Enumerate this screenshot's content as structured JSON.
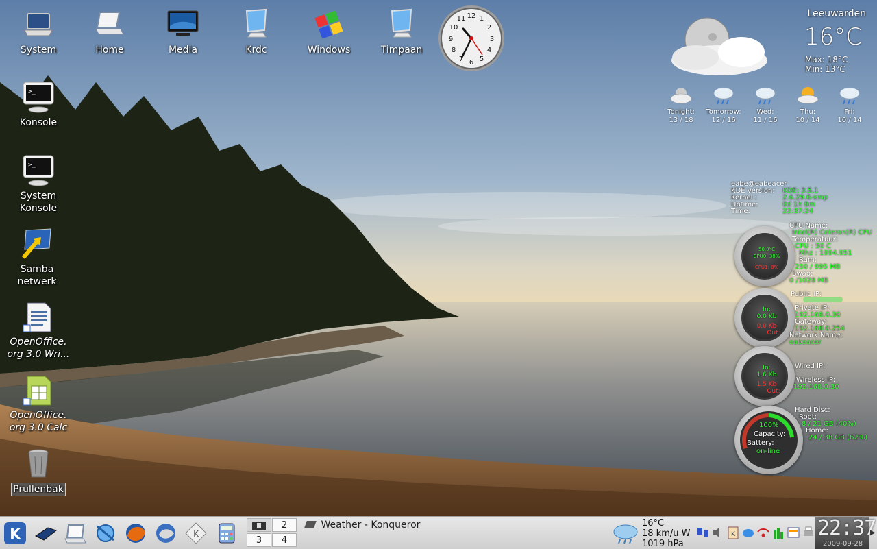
{
  "desktop_icons": [
    {
      "label": "System",
      "icon": "laptop-icon"
    },
    {
      "label": "Home",
      "icon": "laptop-home-icon"
    },
    {
      "label": "Media",
      "icon": "monitor-icon"
    },
    {
      "label": "Krdc",
      "icon": "remote-desktop-icon"
    },
    {
      "label": "Windows",
      "icon": "windows-logo-icon"
    },
    {
      "label": "Timpaan",
      "icon": "remote-desktop-icon"
    },
    {
      "label": "Konsole",
      "icon": "terminal-icon"
    },
    {
      "label": "System\nKonsole",
      "icon": "terminal-icon"
    },
    {
      "label": "Samba\nnetwerk",
      "icon": "network-share-icon"
    },
    {
      "label": "OpenOffice.\norg 3.0 Wri...",
      "icon": "writer-icon"
    },
    {
      "label": "OpenOffice.\norg 3.0 Calc",
      "icon": "calc-icon"
    },
    {
      "label": "Prullenbak",
      "icon": "trash-icon"
    }
  ],
  "clock": {
    "numbers": [
      "12",
      "1",
      "2",
      "3",
      "4",
      "5",
      "6",
      "7",
      "8",
      "9",
      "10",
      "11"
    ]
  },
  "weather": {
    "city": "Leeuwarden",
    "temp": "16°C",
    "max": "Max: 18°C",
    "min": "Min: 13°C",
    "forecast": [
      {
        "day": "Tonight:",
        "range": "13 / 18",
        "icon": "cloud-night-icon"
      },
      {
        "day": "Tomorrow:",
        "range": "12 / 16",
        "icon": "rain-icon"
      },
      {
        "day": "Wed:",
        "range": "11 / 16",
        "icon": "rain-icon"
      },
      {
        "day": "Thu:",
        "range": "10 / 14",
        "icon": "sun-cloud-icon"
      },
      {
        "day": "Fri:",
        "range": "10 / 14",
        "icon": "rain-icon"
      }
    ]
  },
  "sysmon": {
    "user": "eabe@eabeacer",
    "kde_label": "KDE version:",
    "kde_value": "KDE: 3.5.1",
    "kernel_label": "Kernel :",
    "kernel_value": "2.6.29.6-smp",
    "uptime_label": "Uptime:",
    "uptime_value": "0d 1h 8m",
    "time_label": "Time:",
    "time_value": "22:37:24",
    "cpu_name_label": "CPU Name:",
    "cpu_name_value": "Intel(R) Celeron(R) CPU",
    "temp_label": "Temperatuur:",
    "cpu_temp": "CPU :   50 C",
    "mhz": "Mhz :  1994.951",
    "ram_label": "Ram:",
    "ram_value": "250 /  995 MB",
    "swap_label": "Swap:",
    "swap_value": "0  /1028 MB",
    "gauge1_a": "50.0°C",
    "gauge1_b": "CPU0:  38%",
    "gauge1_c": "CPU1:   0%",
    "public_ip_label": "Public IP:",
    "private_ip_label": "Private IP:",
    "private_ip_value": "192.168.0.30",
    "gateway_label": "Gateway:",
    "gateway_value": "192.168.0.254",
    "network_name_label": "Network Name:",
    "network_name_value": "eabeacer",
    "gauge2_in_label": "In:",
    "gauge2_in_value": "0.0 Kb",
    "gauge2_out_value": "0.0 Kb",
    "gauge2_out_label": "Out:",
    "wired_ip_label": "Wired IP:",
    "wireless_ip_label": "Wireless IP:",
    "wireless_ip_value": "192.168.0.30",
    "gauge3_in_label": "In:",
    "gauge3_in_value": "1.6 Kb",
    "gauge3_out_value": "1.5 Kb",
    "gauge3_out_label": "Out:",
    "hd_label": "Hard Disc:",
    "root_label": "Root:",
    "root_value": "8 / 21 GB  (40%)",
    "home_label": "Home:",
    "home_value": "24 / 38 GB  (62%)",
    "battery_pct": "100%",
    "capacity_label": "Capacity:",
    "battery_label": "Battery:",
    "battery_state": "on-line"
  },
  "taskbar": {
    "launchers": [
      "kde-menu-icon",
      "desktop-show-icon",
      "home-laptop-icon",
      "konqueror-icon",
      "firefox-icon",
      "thunderbird-icon",
      "kmail-icon",
      "calculator-icon"
    ],
    "pager": [
      "1",
      "2",
      "3",
      "4"
    ],
    "task_title": "Weather - Konqueror",
    "tray_weather": {
      "temp": "16°C",
      "wind": "18 km/u W",
      "pressure": "1019 hPa"
    },
    "tray_icons": [
      "network-icon",
      "volume-icon",
      "klipper-icon",
      "kde-icon",
      "network-wlan-icon",
      "power-icon",
      "update-icon",
      "printer-icon"
    ],
    "clock_time": "22:37",
    "clock_date": "2009-09-28"
  }
}
